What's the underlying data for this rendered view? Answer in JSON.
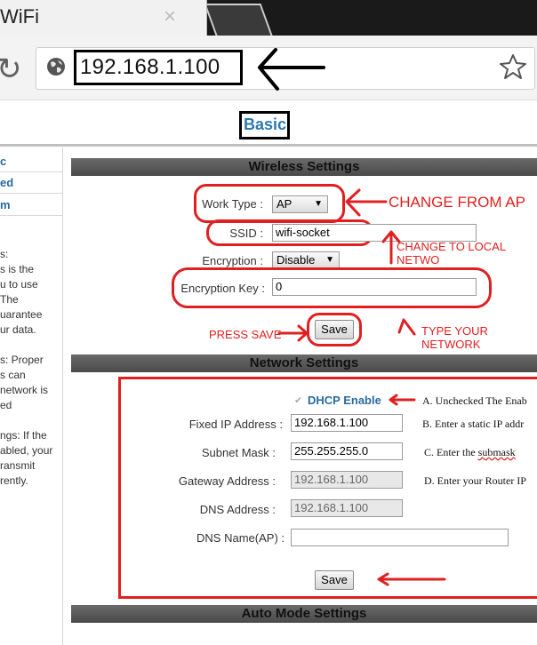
{
  "browser": {
    "tab_title": "WiFi",
    "tab_close": "×",
    "url": "192.168.1.100"
  },
  "page": {
    "basic_link": "Basic",
    "nav": [
      "c",
      "ed",
      "m"
    ],
    "help_text": "s:\ns is the\nu to use\nThe\nuarantee\nur data.\n\ns: Proper\ns can\nnetwork is\ned\n\nngs: If the\nabled, your\nransmit\nrently."
  },
  "wireless": {
    "header": "Wireless Settings",
    "work_type_label": "Work Type :",
    "work_type_value": "AP",
    "ssid_label": "SSID :",
    "ssid_value": "wifi-socket",
    "encryption_label": "Encryption :",
    "encryption_value": "Disable",
    "encryption_key_label": "Encryption Key :",
    "encryption_key_value": "0",
    "save_label": "Save"
  },
  "network": {
    "header": "Network Settings",
    "dhcp_label": "DHCP Enable",
    "fixed_ip_label": "Fixed IP Address :",
    "fixed_ip_value": "192.168.1.100",
    "subnet_label": "Subnet Mask :",
    "subnet_value": "255.255.255.0",
    "gateway_label": "Gateway Address :",
    "gateway_value": "192.168.1.100",
    "dns_label": "DNS Address :",
    "dns_value": "192.168.1.100",
    "dns_name_label": "DNS Name(AP) :",
    "dns_name_value": "",
    "save_label": "Save"
  },
  "auto_mode": {
    "header": "Auto Mode Settings"
  },
  "annotations": {
    "change_from_ap": "CHANGE FROM AP",
    "change_to_local": "CHANGE TO LOCAL NETWO",
    "press_save": "PRESS SAVE",
    "type_your_network": "TYPE YOUR NETWORK",
    "note_a": "A. Unchecked The Enab",
    "note_b": "B.  Enter a static IP addr",
    "note_c_prefix": "C. Enter the ",
    "note_c_word": "submask",
    "note_d": "D. Enter your Router IP"
  },
  "colors": {
    "annotation_red": "#e02020",
    "link_blue": "#2a7ab0"
  }
}
